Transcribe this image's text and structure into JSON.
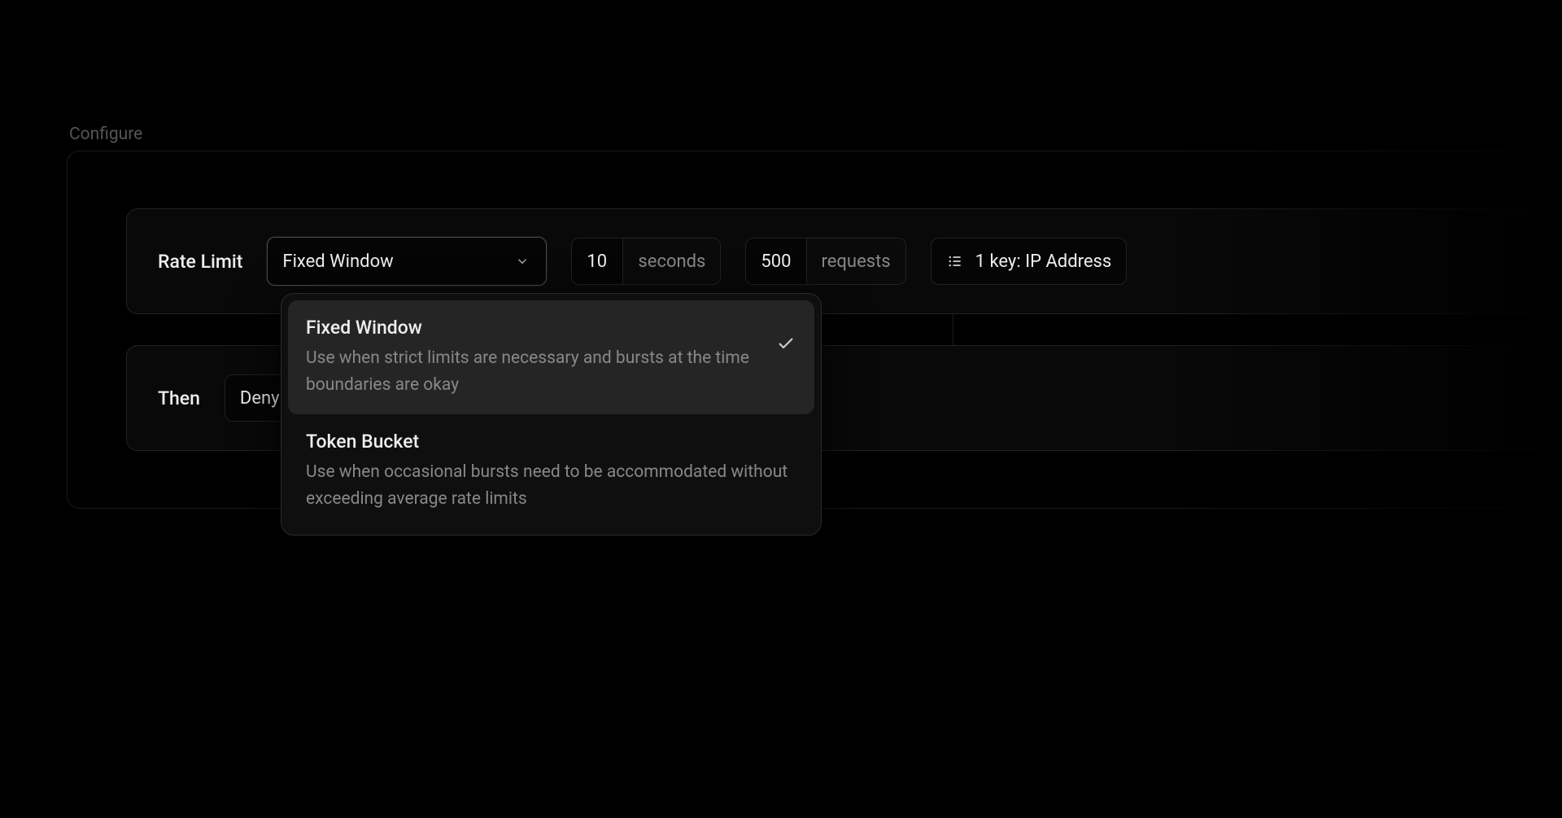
{
  "page": {
    "title": "Configure"
  },
  "rateLimit": {
    "label": "Rate Limit",
    "algorithm": {
      "selected": "Fixed Window",
      "options": [
        {
          "title": "Fixed Window",
          "description": "Use when strict limits are necessary and bursts at the time boundaries are okay",
          "selected": true
        },
        {
          "title": "Token Bucket",
          "description": "Use when occasional bursts need to be accommodated without exceeding average rate limits",
          "selected": false
        }
      ]
    },
    "interval": {
      "value": "10",
      "unit": "seconds"
    },
    "limit": {
      "value": "500",
      "unit": "requests"
    },
    "key": {
      "label": "1 key: IP Address"
    }
  },
  "action": {
    "label": "Then",
    "value": "Deny"
  }
}
